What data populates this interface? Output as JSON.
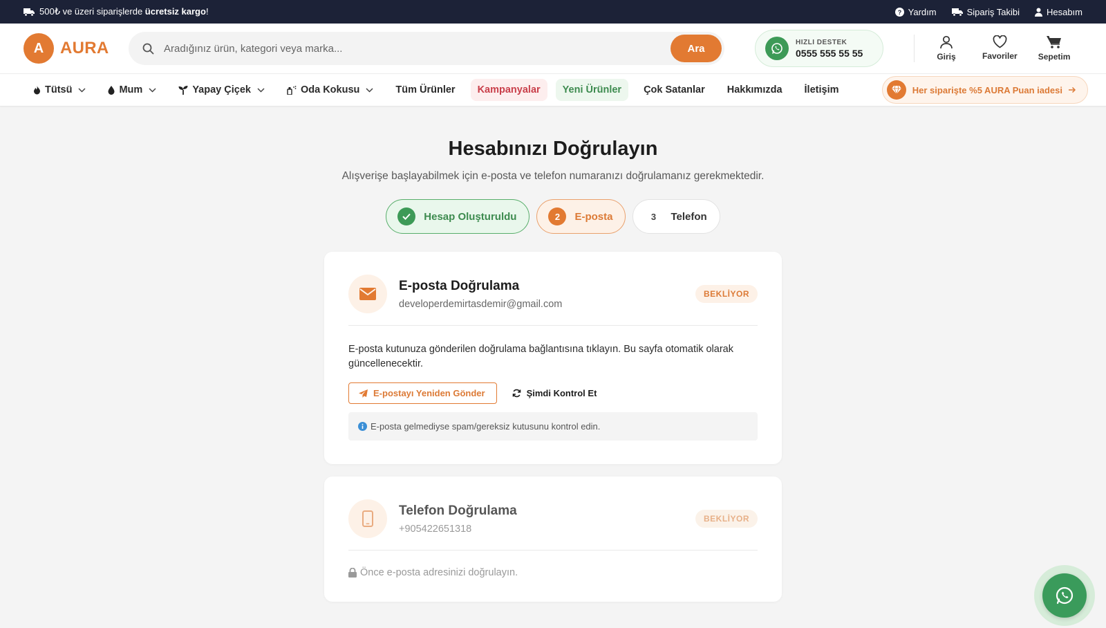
{
  "colors": {
    "accent": "#e27a32",
    "dark": "#1c2237",
    "success": "#3d9a57",
    "campaign": "#c93f4a"
  },
  "topbar": {
    "promo_prefix": "500₺ ve üzeri siparişlerde ",
    "promo_bold": "ücretsiz kargo",
    "promo_suffix": "!",
    "links": [
      "Yardım",
      "Sipariş Takibi",
      "Hesabım"
    ]
  },
  "header": {
    "logo_letter": "A",
    "logo_text": "AURA",
    "search_placeholder": "Aradığınız ürün, kategori veya marka...",
    "search_button": "Ara",
    "support_label": "HIZLI DESTEK",
    "support_phone": "0555 555 55 55",
    "icons": [
      "Giriş",
      "Favoriler",
      "Sepetim"
    ]
  },
  "nav": {
    "items": [
      "Tütsü",
      "Mum",
      "Yapay Çiçek",
      "Oda Kokusu",
      "Tüm Ürünler",
      "Kampanyalar",
      "Yeni Ürünler",
      "Çok Satanlar",
      "Hakkımızda",
      "İletişim"
    ],
    "promo": "Her siparişte %5 AURA Puan iadesi"
  },
  "main": {
    "title": "Hesabınızı Doğrulayın",
    "subtitle": "Alışverişe başlayabilmek için e-posta ve telefon numaranızı doğrulamanız gerekmektedir.",
    "steps": [
      {
        "num": "",
        "label": "Hesap Oluşturuldu",
        "state": "done"
      },
      {
        "num": "2",
        "label": "E-posta",
        "state": "active"
      },
      {
        "num": "3",
        "label": "Telefon",
        "state": "todo"
      }
    ]
  },
  "email_card": {
    "title": "E-posta Doğrulama",
    "email": "developerdemirtasdemir@gmail.com",
    "badge": "BEKLİYOR",
    "text": "E-posta kutunuza gönderilen doğrulama bağlantısına tıklayın. Bu sayfa otomatik olarak güncellenecektir.",
    "resend": "E-postayı Yeniden Gönder",
    "check": "Şimdi Kontrol Et",
    "note": "E-posta gelmediyse spam/gereksiz kutusunu kontrol edin."
  },
  "phone_card": {
    "title": "Telefon Doğrulama",
    "phone": "+905422651318",
    "badge": "BEKLİYOR",
    "locked": "Önce e-posta adresinizi doğrulayın."
  }
}
